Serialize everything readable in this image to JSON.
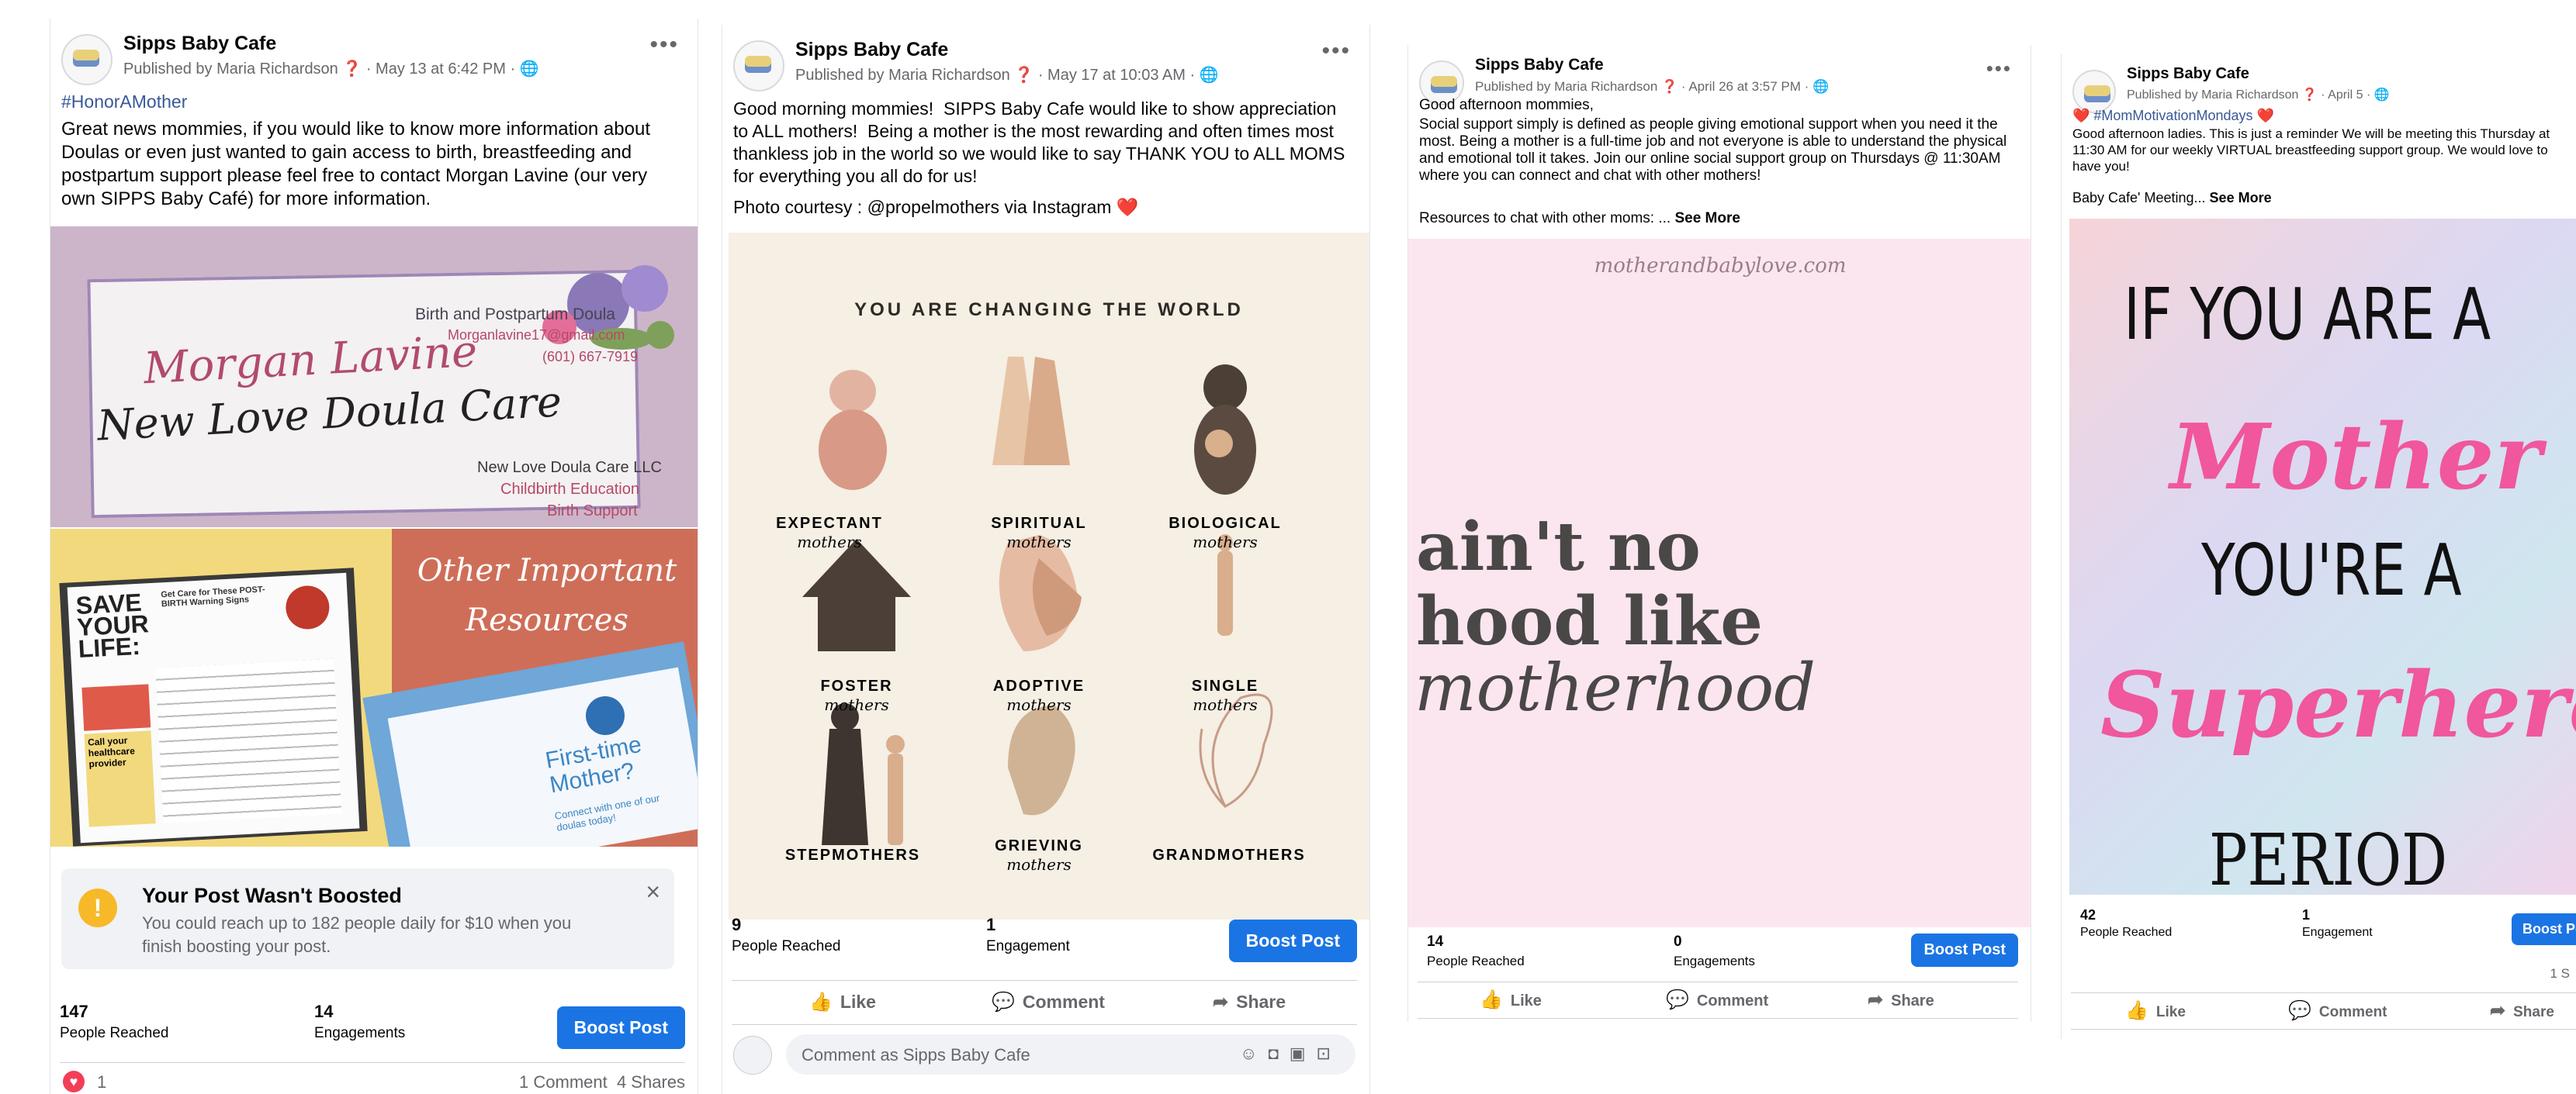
{
  "post1": {
    "page_name": "Sipps Baby Cafe",
    "meta": "Published by Maria Richardson ❓ · May 13 at 6:42 PM · 🌐",
    "hashtag": "#HonorAMother",
    "text": "Great news mommies, if you would like to know more information about Doulas or even just wanted to gain access to birth, breastfeeding and postpartum support please feel free to contact Morgan Lavine (our very own SIPPS Baby Café) for more information.",
    "card": {
      "heading1": "Birth and Postpartum Doula",
      "email": "Morganlavine17@gmail.com",
      "phone": "(601) 667-7919",
      "name": "Morgan Lavine",
      "business": "New Love Doula Care",
      "llc": "New Love Doula Care LLC",
      "edu": "Childbirth Education",
      "support": "Birth Support"
    },
    "resources": {
      "title_line1": "Other Important",
      "title_line2": "Resources",
      "save1": "SAVE",
      "save2": "YOUR",
      "save3": "LIFE:",
      "post_birth": "Get Care for These POST-BIRTH Warning Signs",
      "call_provider": "Call your healthcare provider",
      "first_time": "First-time Mother?",
      "connect": "Connect with one of our doulas today!"
    },
    "boost_notice": {
      "title": "Your Post Wasn't Boosted",
      "body": "You could reach up to 182 people daily for $10 when you finish boosting your post."
    },
    "stats": {
      "reached": "147",
      "reached_label": "People Reached",
      "engagements": "14",
      "engagements_label": "Engagements",
      "boost": "Boost Post"
    },
    "footer": {
      "reactions": "1",
      "comments_shares": "1 Comment  4 Shares"
    }
  },
  "post2": {
    "page_name": "Sipps Baby Cafe",
    "meta": "Published by Maria Richardson ❓ · May 17 at 10:03 AM · 🌐",
    "text": "Good morning mommies!  SIPPS Baby Cafe would like to show appreciation to ALL mothers!  Being a mother is the most rewarding and often times most thankless job in the world so we would like to say THANK YOU to ALL MOMS for everything you all do for us!",
    "photo_credit": "Photo courtesy : @propelmothers via Instagram ❤️",
    "poster": {
      "title": "YOU ARE CHANGING THE WORLD",
      "mothers_word": "mothers",
      "items": [
        "EXPECTANT",
        "SPIRITUAL",
        "BIOLOGICAL",
        "FOSTER",
        "ADOPTIVE",
        "SINGLE",
        "STEPMOTHERS",
        "GRIEVING",
        "GRANDMOTHERS"
      ]
    },
    "stats": {
      "reached": "9",
      "reached_label": "People Reached",
      "engagements": "1",
      "engagements_label": "Engagement",
      "boost": "Boost Post"
    },
    "actions": {
      "like": "Like",
      "comment": "Comment",
      "share": "Share"
    },
    "comment_placeholder": "Comment as Sipps Baby Cafe"
  },
  "post3": {
    "page_name": "Sipps Baby Cafe",
    "meta": "Published by Maria Richardson ❓ · April 26 at 3:57 PM · 🌐",
    "greeting": "Good afternoon mommies,",
    "text": "Social support simply is defined as people giving emotional support when you need it the most. Being a mother is a full-time job and not everyone is able to understand the physical and emotional toll it takes. Join our online social support group on Thursdays @ 11:30AM where you can connect and chat with other mothers!",
    "resources": "Resources to chat with other moms: ...",
    "see_more": "See More",
    "image": {
      "url_text": "motherandbabylove.com",
      "line1": "ain't no",
      "line2": "hood like",
      "line3": "motherhood"
    },
    "stats": {
      "reached": "14",
      "reached_label": "People Reached",
      "engagements": "0",
      "engagements_label": "Engagements",
      "boost": "Boost Post"
    },
    "actions": {
      "like": "Like",
      "comment": "Comment",
      "share": "Share"
    }
  },
  "post4": {
    "page_name": "Sipps Baby Cafe",
    "meta": "Published by Maria Richardson ❓ · April 5 · 🌐",
    "hashtag": "❤️ #MomMotivationMondays ❤️",
    "text": "Good afternoon ladies. This is just a reminder We will be meeting this Thursday at 11:30 AM for our weekly VIRTUAL breastfeeding support group. We would love to have you!",
    "meeting": "Baby Cafe' Meeting...",
    "see_more": "See More",
    "image": {
      "line1": "IF YOU ARE A",
      "line2": "Mother",
      "line3": "YOU'RE A",
      "line4": "Superhero,",
      "line5": "PERIOD"
    },
    "stats": {
      "reached": "42",
      "reached_label": "People Reached",
      "engagements": "1",
      "engagements_label": "Engagement",
      "boost": "Boost Post",
      "shares": "1 S"
    },
    "actions": {
      "like": "Like",
      "comment": "Comment",
      "share": "Share"
    }
  }
}
